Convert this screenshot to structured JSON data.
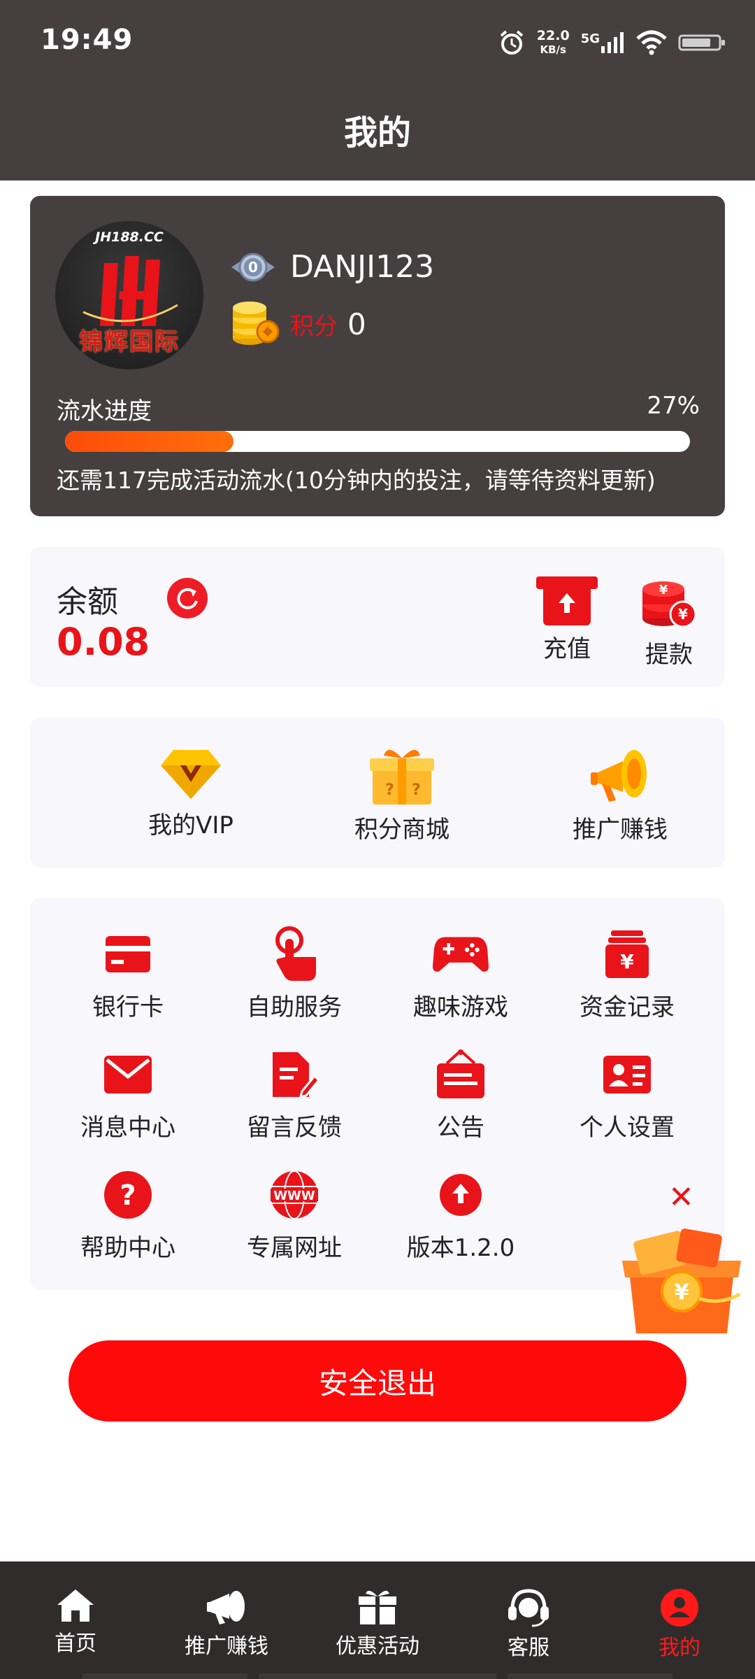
{
  "status_bar": {
    "time": "19:49",
    "net_speed_value": "22.0",
    "net_speed_unit": "KB/s",
    "network": "5G",
    "icons": [
      "alarm-icon",
      "signal-icon",
      "wifi-icon",
      "battery-icon"
    ]
  },
  "header": {
    "title": "我的"
  },
  "profile": {
    "avatar_domain": "JH188.CC",
    "avatar_brand": "锦辉国际",
    "vip_level": "0",
    "username": "DANJI123",
    "points_label": "积分",
    "points_value": "0",
    "progress_label": "流水进度",
    "progress_percent_text": "27%",
    "progress_fraction": 0.27,
    "progress_note": "还需117完成活动流水(10分钟内的投注，请等待资料更新)"
  },
  "balance": {
    "label": "余额",
    "value": "0.08",
    "recharge_label": "充值",
    "withdraw_label": "提款"
  },
  "quick_links": [
    {
      "label": "我的VIP",
      "icon": "vip-diamond-icon"
    },
    {
      "label": "积分商城",
      "icon": "gift-box-icon"
    },
    {
      "label": "推广赚钱",
      "icon": "megaphone-icon"
    }
  ],
  "grid": [
    {
      "label": "银行卡",
      "icon": "bank-card-icon"
    },
    {
      "label": "自助服务",
      "icon": "tap-hand-icon"
    },
    {
      "label": "趣味游戏",
      "icon": "gamepad-icon"
    },
    {
      "label": "资金记录",
      "icon": "money-record-icon"
    },
    {
      "label": "消息中心",
      "icon": "mail-icon"
    },
    {
      "label": "留言反馈",
      "icon": "feedback-icon"
    },
    {
      "label": "公告",
      "icon": "notice-board-icon"
    },
    {
      "label": "个人设置",
      "icon": "id-card-icon"
    },
    {
      "label": "帮助中心",
      "icon": "help-icon"
    },
    {
      "label": "专属网址",
      "icon": "www-icon"
    },
    {
      "label": "版本1.2.0",
      "icon": "upload-icon"
    }
  ],
  "logout_label": "安全退出",
  "bottom_nav": [
    {
      "label": "首页",
      "icon": "home-icon",
      "active": false
    },
    {
      "label": "推广赚钱",
      "icon": "megaphone-icon",
      "active": false
    },
    {
      "label": "优惠活动",
      "icon": "gift-icon",
      "active": false
    },
    {
      "label": "客服",
      "icon": "headset-icon",
      "active": false
    },
    {
      "label": "我的",
      "icon": "user-icon",
      "active": true
    }
  ],
  "colors": {
    "header_bg": "#463f3f",
    "accent_red": "#e8141a",
    "progress_orange": "#ff5a0a",
    "card_bg": "#f7f7fc",
    "nav_bg": "#302c2c"
  }
}
